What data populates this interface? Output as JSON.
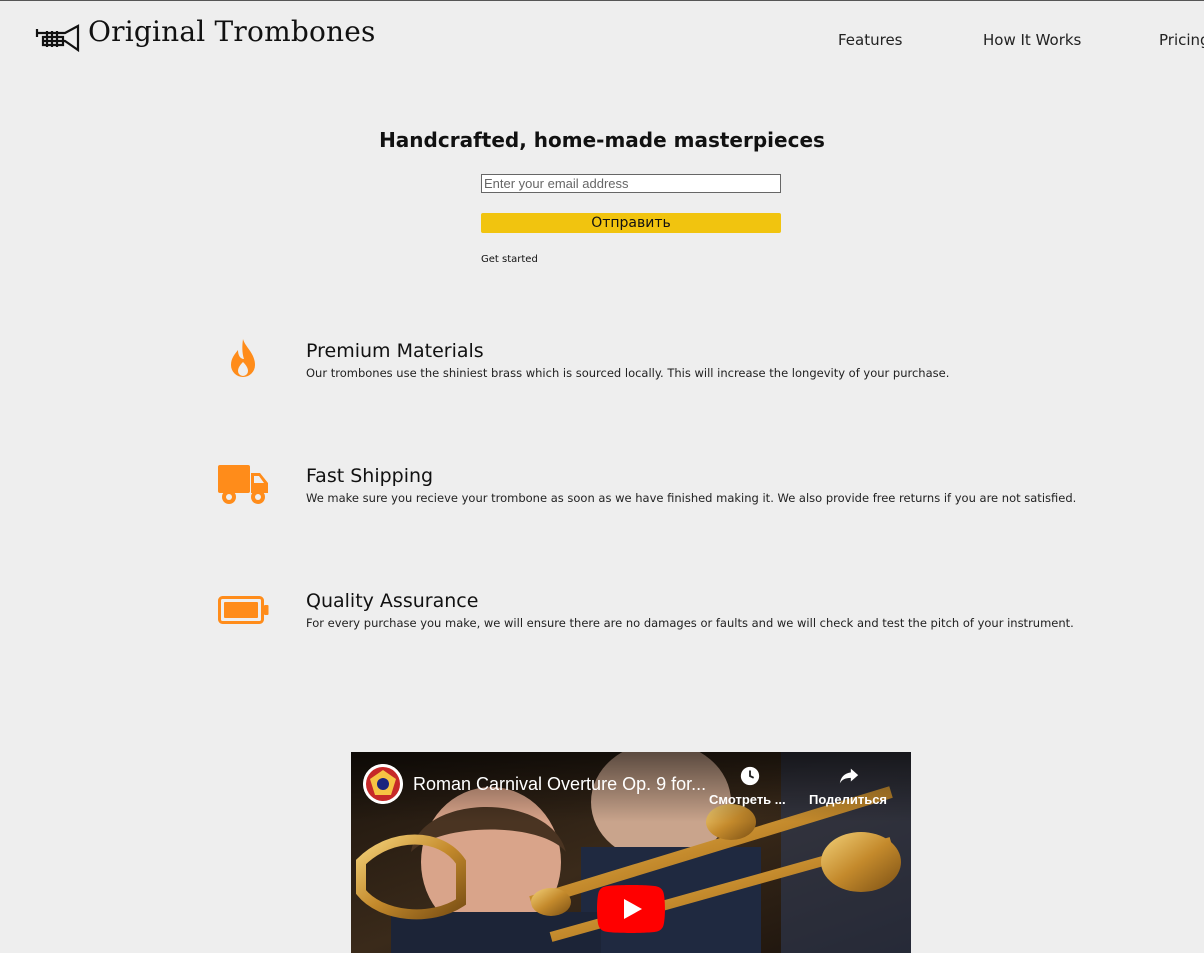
{
  "header": {
    "brand": "Original Trombones",
    "nav": [
      {
        "label": "Features"
      },
      {
        "label": "How It Works"
      },
      {
        "label": "Pricing"
      }
    ]
  },
  "hero": {
    "title": "Handcrafted, home-made masterpieces",
    "email_placeholder": "Enter your email address",
    "submit_label": "Отправить",
    "get_started": "Get started"
  },
  "features": [
    {
      "icon": "fire-icon",
      "title": "Premium Materials",
      "description": "Our trombones use the shiniest brass which is sourced locally. This will increase the longevity of your purchase."
    },
    {
      "icon": "truck-icon",
      "title": "Fast Shipping",
      "description": "We make sure you recieve your trombone as soon as we have finished making it. We also provide free returns if you are not satisfied."
    },
    {
      "icon": "battery-icon",
      "title": "Quality Assurance",
      "description": "For every purchase you make, we will ensure there are no damages or faults and we will check and test the pitch of your instrument."
    }
  ],
  "video": {
    "title": "Roman Carnival Overture Op. 9 for...",
    "watch_later": "Смотреть ...",
    "share": "Поделиться"
  },
  "colors": {
    "accent_orange": "#ff8c1a",
    "button_yellow": "#f1c40f",
    "background": "#eeeeee",
    "youtube_red": "#ff0000"
  }
}
